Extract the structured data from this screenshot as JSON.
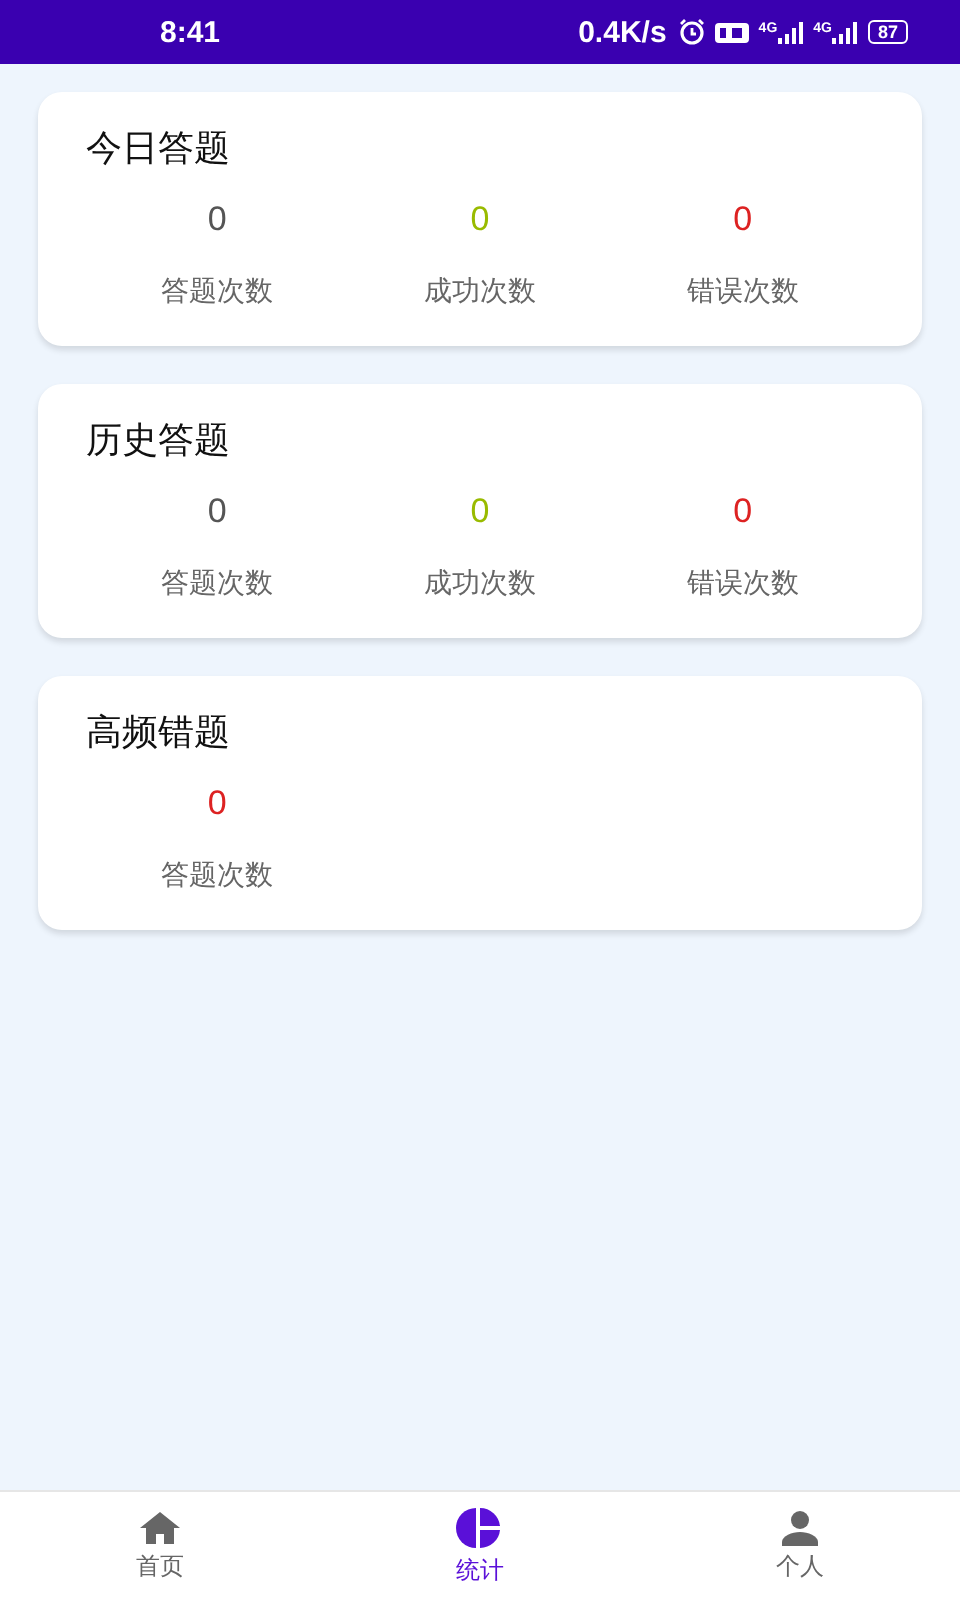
{
  "status_bar": {
    "time": "8:41",
    "speed": "0.4K/s",
    "signal_labels": [
      "4G",
      "4G"
    ],
    "battery": "87"
  },
  "cards": [
    {
      "title": "今日答题",
      "stats": [
        {
          "value": "0",
          "label": "答题次数",
          "color": "#555555"
        },
        {
          "value": "0",
          "label": "成功次数",
          "color": "#99bb00"
        },
        {
          "value": "0",
          "label": "错误次数",
          "color": "#dd2222"
        }
      ]
    },
    {
      "title": "历史答题",
      "stats": [
        {
          "value": "0",
          "label": "答题次数",
          "color": "#555555"
        },
        {
          "value": "0",
          "label": "成功次数",
          "color": "#99bb00"
        },
        {
          "value": "0",
          "label": "错误次数",
          "color": "#dd2222"
        }
      ]
    },
    {
      "title": "高频错题",
      "stats": [
        {
          "value": "0",
          "label": "答题次数",
          "color": "#dd2222"
        }
      ]
    }
  ],
  "tabs": [
    {
      "label": "首页",
      "selected": false
    },
    {
      "label": "统计",
      "selected": true
    },
    {
      "label": "个人",
      "selected": false
    }
  ]
}
